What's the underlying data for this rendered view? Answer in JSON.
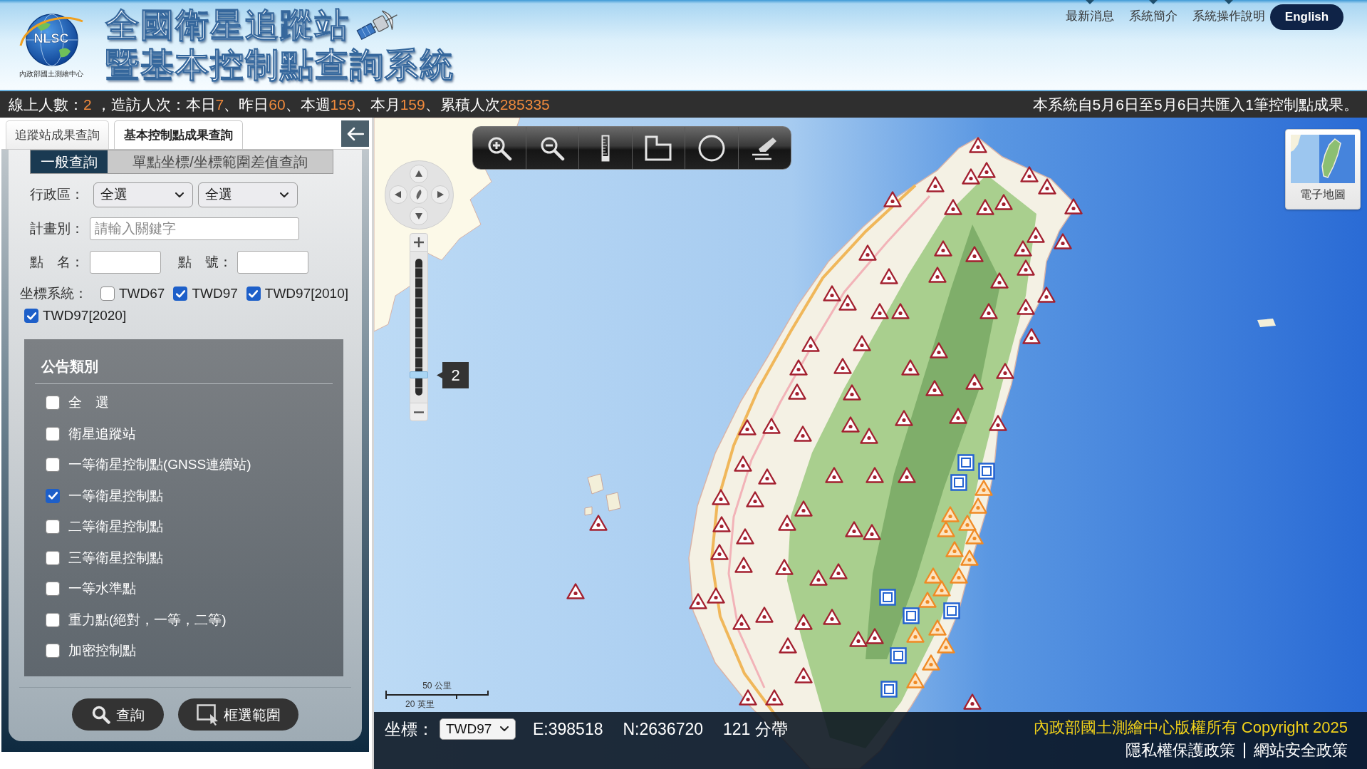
{
  "header": {
    "logo": {
      "text": "NLSC",
      "caption": "內政部國土測繪中心"
    },
    "title_lines": [
      "全國衛星追蹤站",
      "暨基本控制點查詢系統"
    ],
    "nav_links": [
      "最新消息",
      "系統簡介",
      "系統操作說明"
    ],
    "language_button": "English"
  },
  "stats_bar": {
    "visits": [
      {
        "label": "線上人數：",
        "value": "2"
      },
      {
        "label": " ，造訪人次：本日",
        "value": "7"
      },
      {
        "label": "、昨日",
        "value": "60"
      },
      {
        "label": "、本週",
        "value": "159"
      },
      {
        "label": "、本月",
        "value": "159"
      },
      {
        "label": "、累積人次",
        "value": "285335"
      }
    ],
    "import_notice": "本系統自5月6日至5月6日共匯入1筆控制點成果。"
  },
  "side_panel": {
    "tabs": [
      {
        "label": "追蹤站成果查詢",
        "selected": false
      },
      {
        "label": "基本控制點成果查詢",
        "selected": true
      }
    ],
    "query_tabs": [
      {
        "label": "一般查詢",
        "selected": true
      },
      {
        "label": "單點坐標/坐標範圍差值查詢",
        "selected": false
      }
    ],
    "district": {
      "label": "行政區：",
      "selects": [
        "全選",
        "全選"
      ]
    },
    "plan": {
      "label": "計畫別：",
      "placeholder": "請輸入關鍵字"
    },
    "point_name": {
      "label": "點　名："
    },
    "point_number": {
      "label": "點　號："
    },
    "coordinate_systems": {
      "label": "坐標系統：",
      "options": [
        {
          "label": "TWD67",
          "checked": false
        },
        {
          "label": "TWD97",
          "checked": true
        },
        {
          "label": "TWD97[2010]",
          "checked": true
        },
        {
          "label": "TWD97[2020]",
          "checked": true
        }
      ]
    },
    "announcement_types": {
      "title": "公告類別",
      "options": [
        {
          "label": "全　選",
          "checked": false
        },
        {
          "label": "衛星追蹤站",
          "checked": false
        },
        {
          "label": "一等衛星控制點(GNSS連續站)",
          "checked": false
        },
        {
          "label": "一等衛星控制點",
          "checked": true
        },
        {
          "label": "二等衛星控制點",
          "checked": false
        },
        {
          "label": "三等衛星控制點",
          "checked": false
        },
        {
          "label": "一等水準點",
          "checked": false
        },
        {
          "label": "重力點(絕對，一等，二等)",
          "checked": false
        },
        {
          "label": "加密控制點",
          "checked": false
        }
      ]
    },
    "search_button": "查詢",
    "box_select_button": "框選範圍"
  },
  "map": {
    "zoom": {
      "level": 0.13,
      "tooltip": "2"
    },
    "basemap_button": "電子地圖",
    "scale_bar": {
      "metric": "50 公里",
      "imperial": "20 英里"
    }
  },
  "status_bar": {
    "coordinate_label": "坐標：",
    "coordinate_system": "TWD97",
    "easting": "E:398518",
    "northing": "N:2636720",
    "zone": "121 分帶",
    "copyright": "內政部國土測繪中心版權所有 Copyright 2025",
    "links": [
      "隱私權保護政策",
      "網站安全政策"
    ]
  }
}
